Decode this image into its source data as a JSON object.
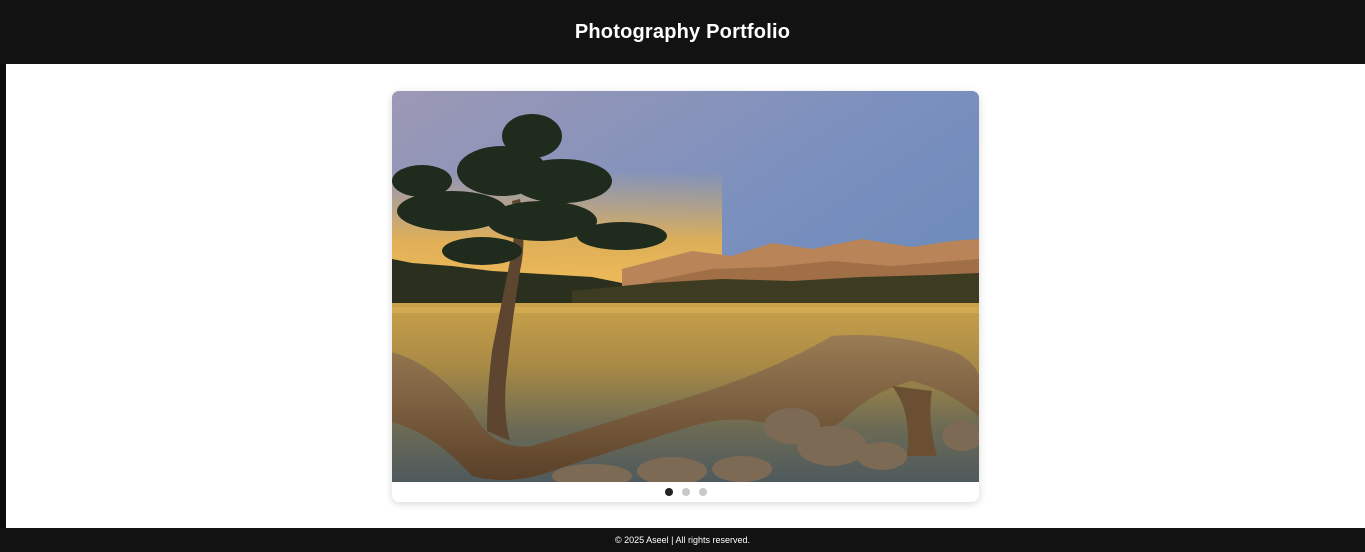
{
  "header": {
    "title": "Photography Portfolio"
  },
  "slider": {
    "slide_count": 3,
    "active_index": 0,
    "dots": [
      {
        "label": "Slide 1",
        "active": true
      },
      {
        "label": "Slide 2",
        "active": false
      },
      {
        "label": "Slide 3",
        "active": false
      }
    ],
    "image_subject": "lake-sunset-with-tree"
  },
  "footer": {
    "text": "© 2025 Aseel | All rights reserved."
  },
  "colors": {
    "header_bg": "#121212",
    "footer_bg": "#121212",
    "page_bg": "#ffffff",
    "dot_active": "#222222",
    "dot_inactive": "#c8c8c8"
  }
}
